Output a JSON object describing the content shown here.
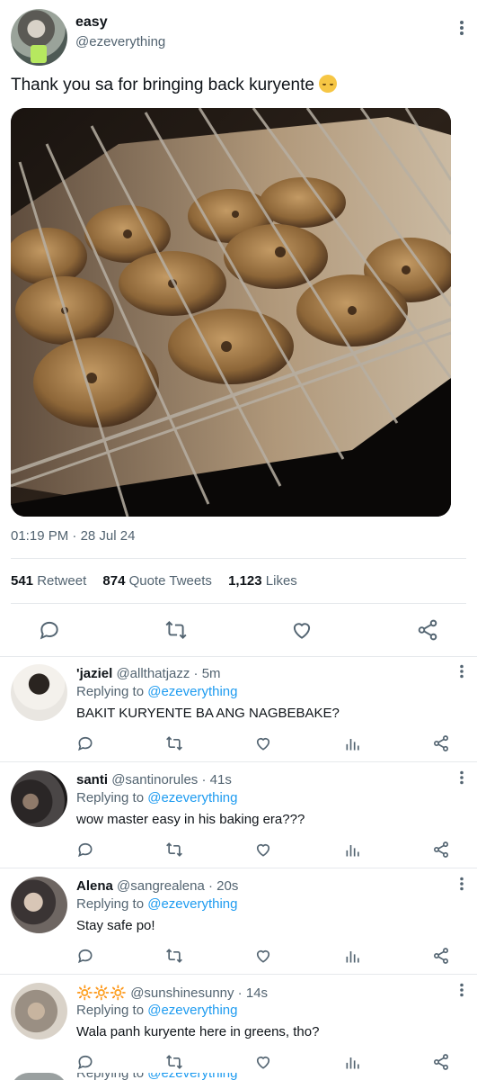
{
  "tweet": {
    "author_name": "easy",
    "author_handle": "@ezeverything",
    "text": "Thank you sa for bringing back kuryente",
    "time": "01:19 PM",
    "date": "28 Jul 24",
    "separator": "·",
    "stats": {
      "retweets_count": "541",
      "retweets_label": "Retweet",
      "quotes_count": "874",
      "quotes_label": "Quote Tweets",
      "likes_count": "1,123",
      "likes_label": "Likes"
    },
    "actions": [
      "comment-icon",
      "retweet-icon",
      "heart-icon",
      "share-icon"
    ]
  },
  "replies": [
    {
      "name": "'jaziel",
      "handle": "@allthatjazz",
      "time": "5m",
      "replying_label": "Replying to",
      "replying_to": "@ezeverything",
      "text": "BAKIT KURYENTE BA ANG NAGBEBAKE?"
    },
    {
      "name": "santi",
      "handle": "@santinorules",
      "time": "41s",
      "replying_label": "Replying to",
      "replying_to": "@ezeverything",
      "text": "wow master easy in his baking era???"
    },
    {
      "name": "Alena",
      "handle": "@sangrealena",
      "time": "20s",
      "replying_label": "Replying to",
      "replying_to": "@ezeverything",
      "text": "Stay safe po!"
    },
    {
      "name": "🔆🔆🔆",
      "handle": "@sunshinesunny",
      "time": "14s",
      "replying_label": "Replying to",
      "replying_to": "@ezeverything",
      "text": "Wala panh kuryente here in greens, tho?"
    }
  ],
  "cutoff_reply": {
    "replying_label": "Replying to",
    "replying_to": "@ezeverything"
  },
  "colors": {
    "link": "#1d9bf0",
    "secondary_text": "#536471",
    "primary_text": "#0f1419",
    "divider": "#e6e9ec"
  }
}
